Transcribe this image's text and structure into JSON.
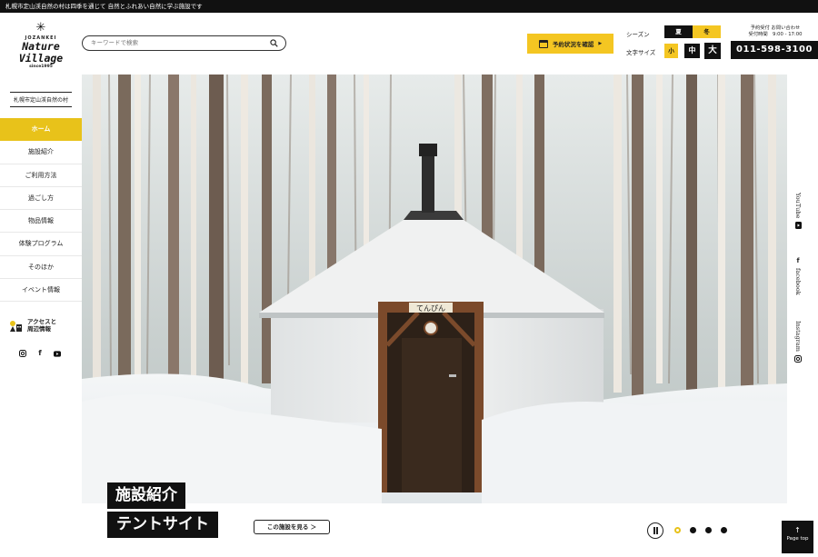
{
  "topbar": {
    "text": "札幌市定山渓自然の村は四季を通じて 自然とふれあい自然に学ぶ施設です"
  },
  "logo": {
    "top_small": "JOZANKEI",
    "line1": "Nature",
    "line2": "Village",
    "since": "since1995",
    "subtitle": "札幌市定山渓自然の村"
  },
  "nav": {
    "items": [
      {
        "label": "ホーム",
        "active": true
      },
      {
        "label": "施設紹介"
      },
      {
        "label": "ご利用方法"
      },
      {
        "label": "過ごし方"
      },
      {
        "label": "物品情報"
      },
      {
        "label": "体験プログラム"
      },
      {
        "label": "そのほか"
      },
      {
        "label": "イベント情報"
      }
    ],
    "access_line1": "アクセスと",
    "access_line2": "周辺情報"
  },
  "search": {
    "placeholder": "キーワードで検索"
  },
  "reserve": {
    "label": "予約状況を確認"
  },
  "season": {
    "label": "シーズン",
    "summer": "夏",
    "winter": "冬"
  },
  "fontsize": {
    "label": "文字サイズ",
    "small": "小",
    "medium": "中",
    "large": "大"
  },
  "contact": {
    "line1": "予約受付 お問い合わせ",
    "line2": "受付時間　9:00 - 17:00",
    "phone": "011-598-3100"
  },
  "hero": {
    "sign": "てんぴん",
    "caption1": "施設紹介",
    "caption2": "テントサイト",
    "more": "この施設を見る ＞"
  },
  "social": {
    "youtube": "YouTube",
    "facebook": "facebook",
    "instagram": "Instagram"
  },
  "pagetop": {
    "arrow": "↑",
    "label": "Page top"
  },
  "colors": {
    "accent": "#e8c21a",
    "reserve": "#f4c622",
    "dark": "#111111"
  }
}
